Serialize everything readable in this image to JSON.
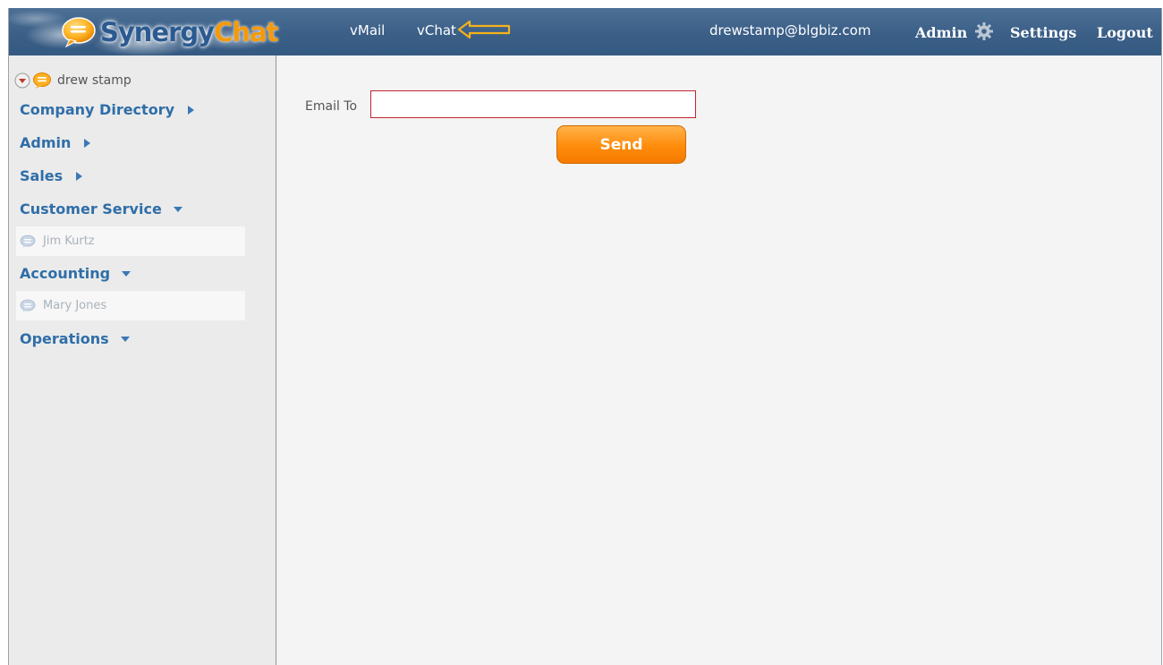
{
  "brand": {
    "part1": "Synergy",
    "part2": "Chat"
  },
  "nav": {
    "vmail": "vMail",
    "vchat": "vChat"
  },
  "user": {
    "email": "drewstamp@blgbiz.com",
    "name": "drew stamp"
  },
  "top_right": {
    "admin": "Admin",
    "settings": "Settings",
    "logout": "Logout"
  },
  "sidebar": {
    "groups": [
      {
        "label": "Company Directory",
        "state": "collapsed"
      },
      {
        "label": "Admin",
        "state": "collapsed"
      },
      {
        "label": "Sales",
        "state": "collapsed"
      },
      {
        "label": "Customer Service",
        "state": "expanded",
        "contacts": [
          "Jim Kurtz"
        ]
      },
      {
        "label": "Accounting",
        "state": "expanded",
        "contacts": [
          "Mary Jones"
        ]
      },
      {
        "label": "Operations",
        "state": "expanded",
        "contacts": []
      }
    ]
  },
  "main": {
    "email_to_label": "Email To",
    "email_to_value": "",
    "send_label": "Send"
  },
  "colors": {
    "topbar": "#3b5f87",
    "link_blue": "#2f6ea8",
    "accent_orange": "#ff8c0b",
    "input_border": "#c0252f"
  }
}
